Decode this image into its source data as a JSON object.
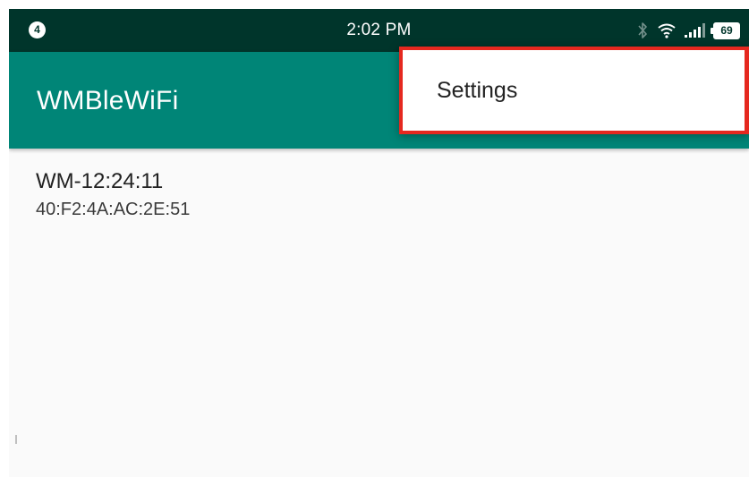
{
  "status_bar": {
    "notification_count": "4",
    "time": "2:02 PM",
    "battery": "69",
    "icons": [
      "bluetooth-icon",
      "wifi-icon",
      "signal-icon",
      "battery-icon"
    ]
  },
  "app_bar": {
    "title": "WMBleWiFi"
  },
  "devices": [
    {
      "name": "WM-12:24:11",
      "address": "40:F2:4A:AC:2E:51"
    }
  ],
  "overflow_menu": {
    "items": [
      {
        "label": "Settings"
      }
    ]
  },
  "colors": {
    "status_bar": "#00352b",
    "app_bar": "#008577",
    "highlight": "#e5281f",
    "background": "#fafafa"
  }
}
